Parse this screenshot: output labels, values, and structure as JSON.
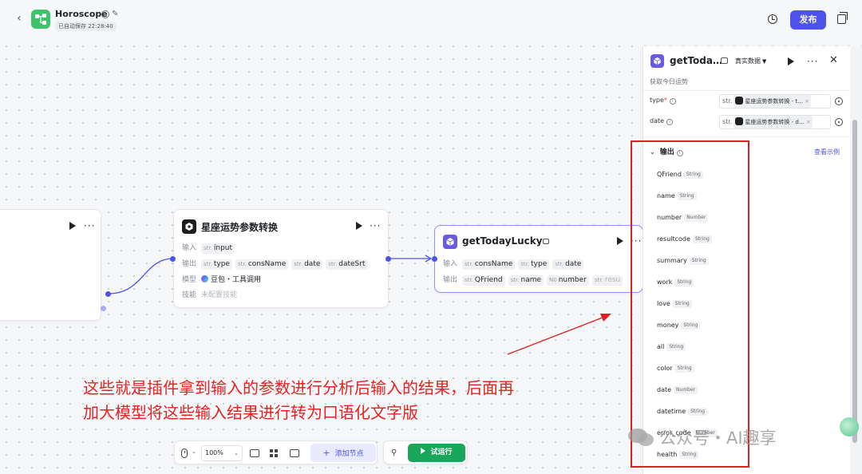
{
  "header": {
    "title": "Horoscope",
    "autosave": "已自动保存 22:28:40",
    "publish_label": "发布"
  },
  "nodes": {
    "middle": {
      "title": "星座运势参数转换",
      "input_label": "输入",
      "input_tags": [
        {
          "t": "str.",
          "name": "input"
        }
      ],
      "output_label": "输出",
      "output_tags": [
        {
          "t": "str.",
          "name": "type"
        },
        {
          "t": "str.",
          "name": "consName"
        },
        {
          "t": "str.",
          "name": "date"
        },
        {
          "t": "str.",
          "name": "dateSrt"
        }
      ],
      "model_label": "模型",
      "model_value": "豆包・工具调用",
      "skill_label": "技能",
      "skill_value": "未配置技能"
    },
    "right": {
      "title": "getTodayLucky",
      "input_label": "输入",
      "input_tags": [
        {
          "t": "str.",
          "name": "consName"
        },
        {
          "t": "str.",
          "name": "type"
        },
        {
          "t": "str.",
          "name": "date"
        }
      ],
      "output_label": "输出",
      "output_tags": [
        {
          "t": "str.",
          "name": "QFriend"
        },
        {
          "t": "str.",
          "name": "name"
        },
        {
          "t": "N0",
          "name": "number"
        },
        {
          "t": "str.",
          "name": "resu"
        }
      ]
    }
  },
  "panel": {
    "title": "getToda…",
    "mode": "真实数据",
    "description": "获取今日运势",
    "params": [
      {
        "label": "type",
        "required": true,
        "str": "str.",
        "chip": "星座运势参数转换 - t…"
      },
      {
        "label": "date",
        "required": false,
        "str": "str.",
        "chip": "星座运势参数转换 - d…"
      }
    ],
    "output_header": "输出",
    "view_example": "查看示例",
    "outputs": [
      {
        "name": "QFriend",
        "type": "String"
      },
      {
        "name": "name",
        "type": "String"
      },
      {
        "name": "number",
        "type": "Number"
      },
      {
        "name": "resultcode",
        "type": "String"
      },
      {
        "name": "summary",
        "type": "String"
      },
      {
        "name": "work",
        "type": "String"
      },
      {
        "name": "love",
        "type": "String"
      },
      {
        "name": "money",
        "type": "String"
      },
      {
        "name": "all",
        "type": "String"
      },
      {
        "name": "color",
        "type": "String"
      },
      {
        "name": "date",
        "type": "Number"
      },
      {
        "name": "datetime",
        "type": "String"
      },
      {
        "name": "error_code",
        "type": "Number"
      },
      {
        "name": "health",
        "type": "String"
      }
    ]
  },
  "annotation": {
    "line1": "这些就是插件拿到输入的参数进行分析后输入的结果，后面再",
    "line2": "加大模型将这些输入结果进行转为口语化文字版"
  },
  "toolbar": {
    "zoom": "100%",
    "add_node_label": "添加节点",
    "run_label": "试运行"
  },
  "watermark": "公众号・AI趣享",
  "colors": {
    "accent": "#4d53e8",
    "run_green": "#18a65a",
    "annotation_red": "#e62222"
  }
}
